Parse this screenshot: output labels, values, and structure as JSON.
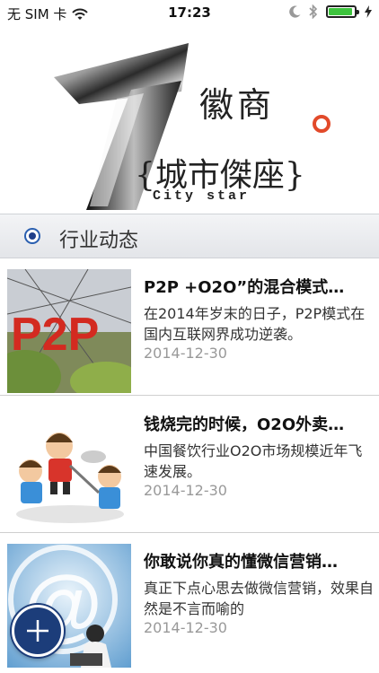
{
  "status_bar": {
    "carrier": "无 SIM 卡",
    "time": "17:23"
  },
  "header": {
    "logo_line1": "徽商",
    "logo_line2": "{城市傑座}",
    "logo_english": "City star"
  },
  "section": {
    "title": "行业动态"
  },
  "news": [
    {
      "title": "P2P +O2O”的混合模式…",
      "summary": "在2014年岁末的日子，P2P模式在国内互联网界成功逆袭。",
      "date": "2014-12-30",
      "thumb_text": "P2P"
    },
    {
      "title": "钱烧完的时候，O2O外卖…",
      "summary": "中国餐饮行业O2O市场规模近年飞速发展。",
      "date": "2014-12-30"
    },
    {
      "title": "你敢说你真的懂微信营销…",
      "summary": "真正下点心思去做微信营销，效果自然是不言而喻的",
      "date": "2014-12-30"
    }
  ]
}
